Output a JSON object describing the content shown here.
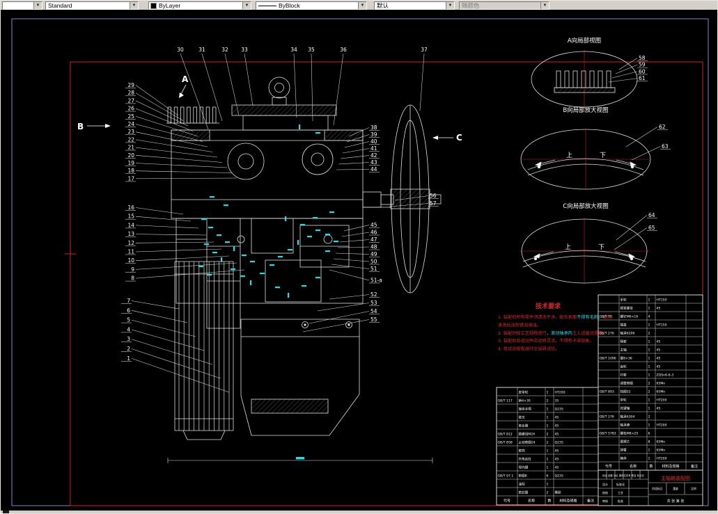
{
  "toolbar": {
    "layer_combo": "",
    "style_combo": "Standard",
    "color_combo": "ByLayer",
    "linetype_combo": "ByBlock",
    "lineweight_combo": "默认",
    "plotstyle_combo": "随颜色"
  },
  "canvas": {
    "view_labels": {
      "a": "A",
      "b": "B",
      "c": "C"
    },
    "detail_views": [
      {
        "title": "A向局部视图",
        "callouts": [
          "58",
          "59",
          "60",
          "61"
        ]
      },
      {
        "title": "B向局部放大视图",
        "callouts": [
          "62",
          "63"
        ],
        "direction_labels": [
          "上",
          "下"
        ]
      },
      {
        "title": "C向局部放大视图",
        "callouts": [
          "64",
          "65"
        ],
        "direction_labels": [
          "上",
          "下"
        ]
      }
    ],
    "callouts": {
      "left_upper": [
        "29",
        "28",
        "27",
        "26",
        "25",
        "24",
        "23",
        "22",
        "21",
        "20",
        "19",
        "18",
        "17"
      ],
      "left_middle": [
        "16",
        "15",
        "14",
        "13",
        "12",
        "11",
        "10",
        "9",
        "8"
      ],
      "left_lower": [
        "7",
        "6",
        "5",
        "4",
        "3",
        "2",
        "1"
      ],
      "top": [
        "30",
        "31",
        "32",
        "33",
        "34",
        "35",
        "36",
        "37"
      ],
      "right_upper": [
        "38",
        "39",
        "40",
        "41",
        "42",
        "43",
        "44"
      ],
      "right_shaft": [
        "56",
        "57"
      ],
      "right_middle": [
        "45",
        "46",
        "47",
        "48",
        "49",
        "50",
        "51",
        "51-a"
      ],
      "right_lower": [
        "52",
        "53",
        "54",
        "55"
      ]
    },
    "tech_requirements": {
      "title": "技术要求",
      "lines": [
        "1. 装配前所有零件须清洗干净，配合表面不得有毛刺、碰伤，",
        "   清洗后涂防锈润滑油。",
        "2. 装配时按工艺规程进行，滚动轴承内注入适量润滑脂。",
        "3. 装配后各运动件应运转灵活，不得有卡滞现象。",
        "4. 按试验规程进行空运转试验。"
      ]
    },
    "bottom_dimension": "400"
  },
  "bom_right": {
    "headers": [
      "代号",
      "名称",
      "数",
      "材料及规格",
      "备注"
    ],
    "rows": [
      [
        "",
        "手轮",
        "1",
        "HT150",
        ""
      ],
      [
        "",
        "锁紧螺母",
        "1",
        "45",
        ""
      ],
      [
        "GB/T 70",
        "螺钉M6×16",
        "4",
        "",
        ""
      ],
      [
        "",
        "端盖",
        "1",
        "HT150",
        ""
      ],
      [
        "GB/T 276",
        "轴承6206",
        "2",
        "",
        ""
      ],
      [
        "",
        "隔套",
        "1",
        "45",
        ""
      ],
      [
        "",
        "主轴",
        "1",
        "45",
        ""
      ],
      [
        "GB/T 1096",
        "键8×36",
        "1",
        "45",
        ""
      ],
      [
        "",
        "齿轮",
        "1",
        "45",
        ""
      ],
      [
        "",
        "衬套",
        "1",
        "ZQSn6-6-3",
        ""
      ],
      [
        "",
        "调整垫圈",
        "2",
        "65Mn",
        ""
      ],
      [
        "GB/T 893",
        "挡圈52",
        "2",
        "65Mn",
        ""
      ],
      [
        "",
        "带轮",
        "1",
        "HT200",
        ""
      ],
      [
        "",
        "花键轴",
        "1",
        "45",
        ""
      ],
      [
        "GB/T 276",
        "轴承6304",
        "2",
        "",
        ""
      ],
      [
        "",
        "轴承座",
        "1",
        "HT200",
        ""
      ],
      [
        "GB/T 5783",
        "螺栓M8×25",
        "6",
        "",
        ""
      ],
      [
        "",
        "摩擦片",
        "8",
        "65Mn",
        ""
      ],
      [
        "",
        "弹簧",
        "1",
        "65Mn",
        ""
      ],
      [
        "",
        "箱体",
        "1",
        "HT200",
        ""
      ]
    ]
  },
  "bom_left": {
    "headers": [
      "代号",
      "名称",
      "数",
      "材料及规格",
      "备注"
    ],
    "rows": [
      [
        "",
        "皮带轮",
        "1",
        "HT200",
        ""
      ],
      [
        "GB/T 117",
        "销4×30",
        "2",
        "35",
        ""
      ],
      [
        "",
        "操纵手柄",
        "1",
        "Q235",
        ""
      ],
      [
        "",
        "拨叉",
        "1",
        "45",
        ""
      ],
      [
        "",
        "离合器",
        "1",
        "45",
        ""
      ],
      [
        "GB/T 812",
        "圆螺母M24",
        "2",
        "45",
        ""
      ],
      [
        "GB/T 858",
        "止动垫圈24",
        "2",
        "Q235",
        ""
      ],
      [
        "",
        "套筒",
        "1",
        "45",
        ""
      ],
      [
        "",
        "升降丝杠",
        "1",
        "45",
        ""
      ],
      [
        "",
        "导向键",
        "1",
        "45",
        ""
      ],
      [
        "GB/T 97.1",
        "垫圈8",
        "6",
        "Q235",
        ""
      ],
      [
        "",
        "油标",
        "1",
        "",
        ""
      ],
      [
        "",
        "密封圈",
        "2",
        "橡胶",
        ""
      ]
    ]
  },
  "title_block": {
    "drawing_name": "主轴箱装配图",
    "top_strip": "标记 处数 分区 更改文件号 签名 年月日",
    "role_labels": [
      "设计",
      "校核",
      "审核",
      "标准化",
      "工艺",
      "批准"
    ],
    "right_labels": [
      "阶段标记",
      "重量",
      "比例"
    ],
    "sheet_label": "共 张 第 张"
  }
}
